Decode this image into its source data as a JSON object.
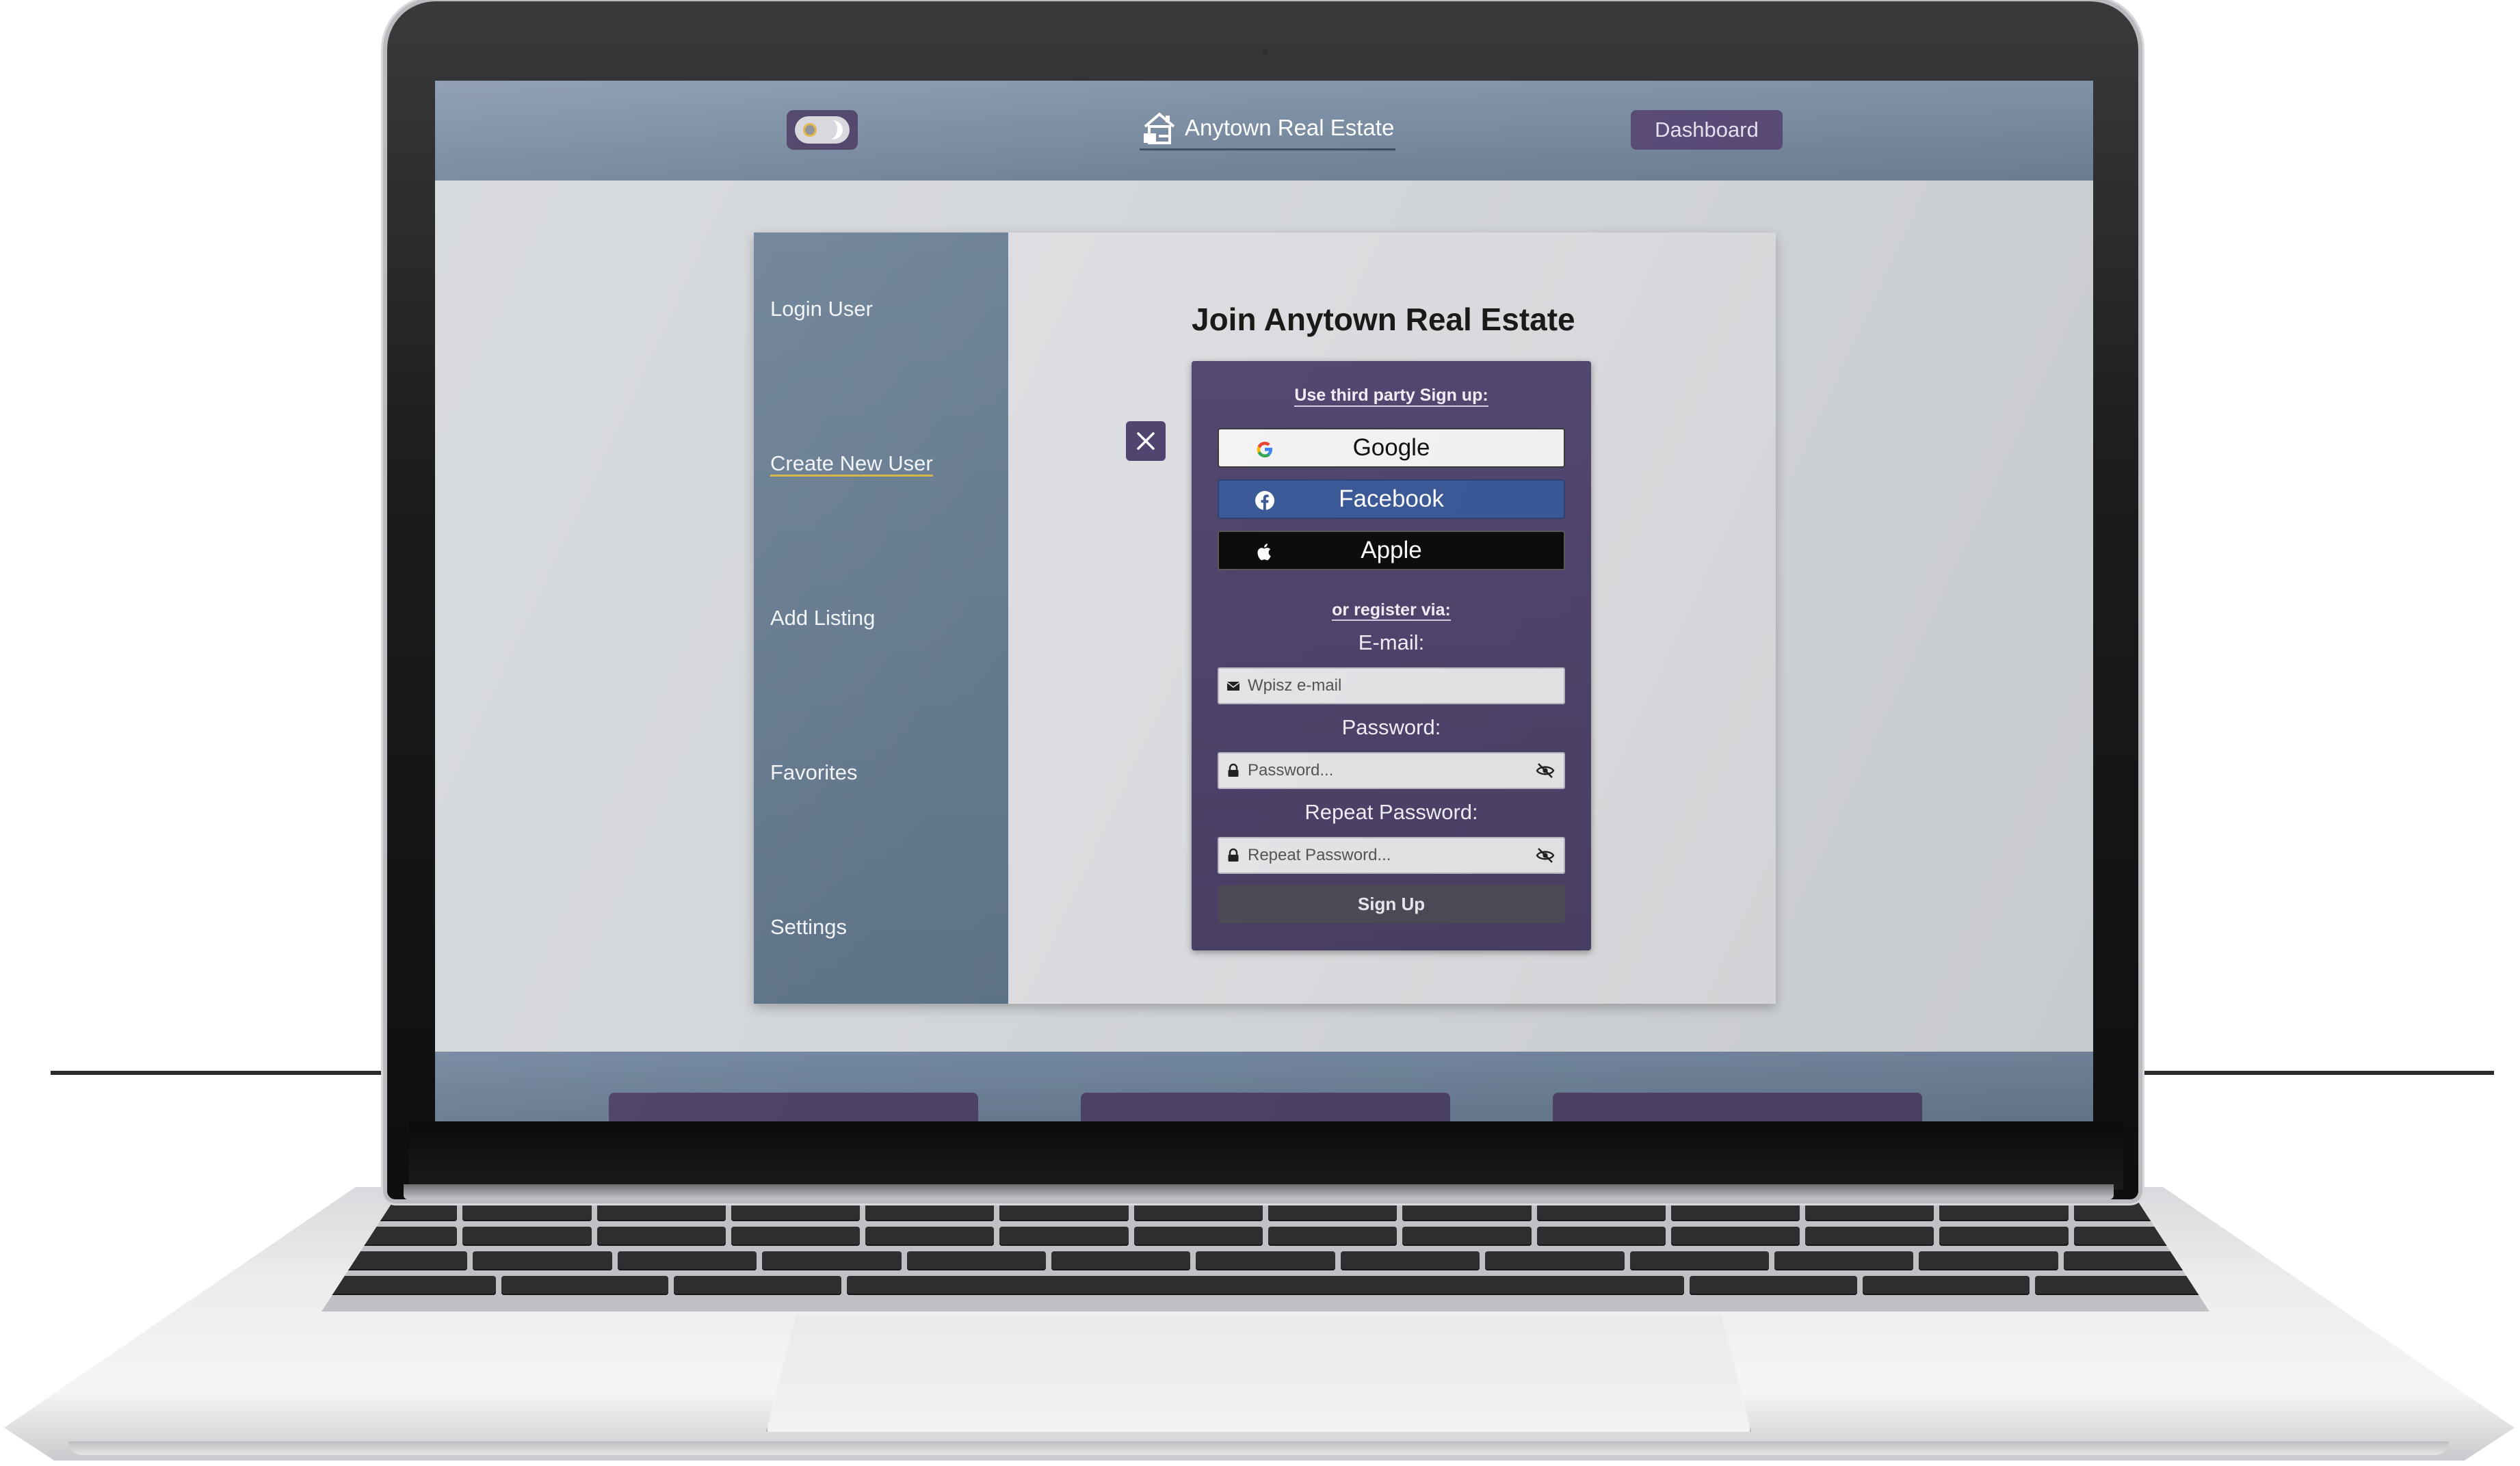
{
  "header": {
    "brand_name": "Anytown Real Estate",
    "dashboard_label": "Dashboard",
    "theme_toggle": "theme-toggle"
  },
  "sidebar": {
    "items": [
      {
        "label": "Login User"
      },
      {
        "label": "Create New User",
        "active": true
      },
      {
        "label": "Add Listing"
      },
      {
        "label": "Favorites"
      },
      {
        "label": "Settings"
      }
    ]
  },
  "signup": {
    "title": "Join Anytown Real Estate",
    "third_party_caption": "Use third party Sign up:",
    "google_label": "Google",
    "facebook_label": "Facebook",
    "apple_label": "Apple",
    "or_caption": "or register via:",
    "email_label": "E-mail:",
    "email_placeholder": "Wpisz e-mail",
    "password_label": "Password:",
    "password_placeholder": "Password...",
    "repeat_label": "Repeat Password:",
    "repeat_placeholder": "Repeat Password...",
    "submit_label": "Sign Up"
  },
  "footer": {
    "tabs": [
      {
        "label": ""
      },
      {
        "label": ""
      },
      {
        "label": ""
      }
    ]
  },
  "colors": {
    "header": "#6e8197",
    "sidebar": "#647a8f",
    "panel": "#4e4369",
    "accent": "#5b4c79",
    "facebook": "#3c5a99",
    "underline": "#d9b346"
  }
}
